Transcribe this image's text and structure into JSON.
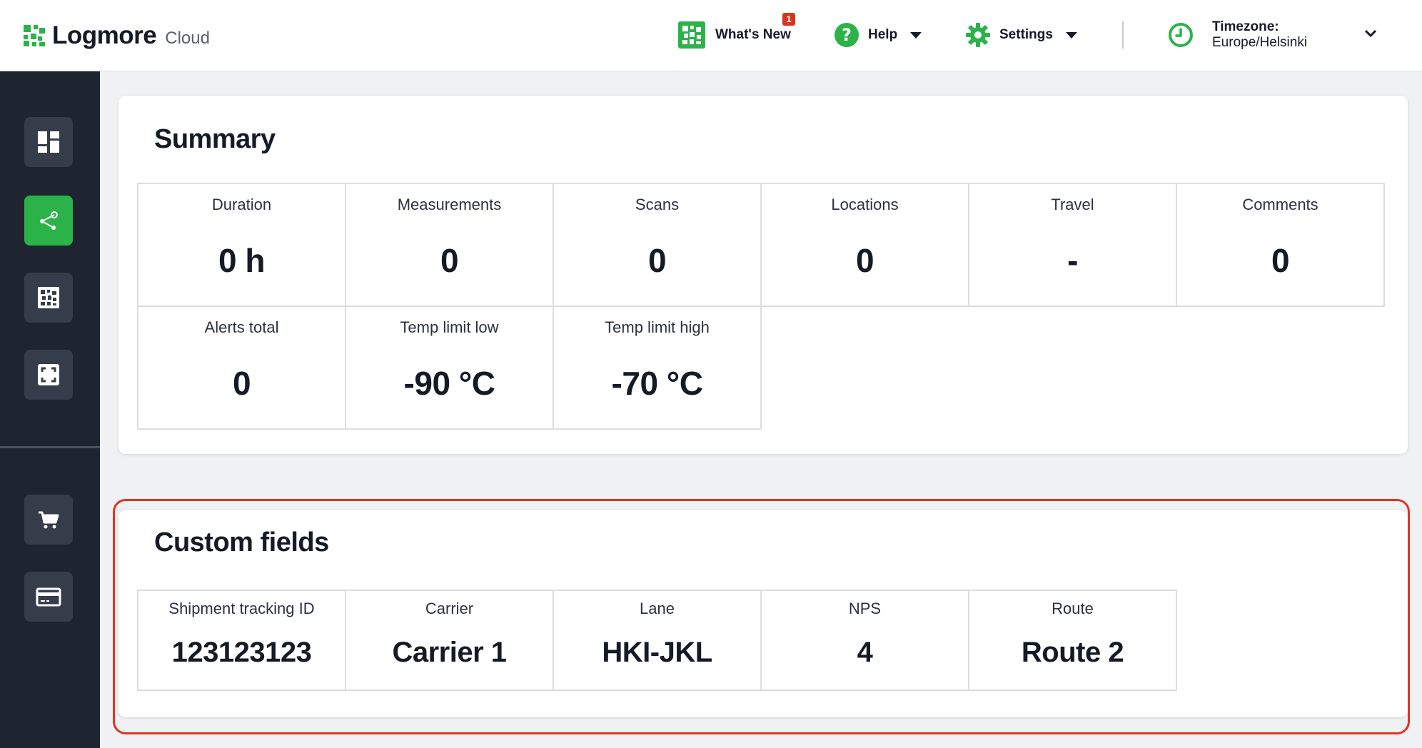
{
  "brand": {
    "name": "Logmore",
    "product": "Cloud"
  },
  "header": {
    "whats_new": {
      "label": "What's New",
      "badge": "1"
    },
    "help": {
      "label": "Help"
    },
    "settings": {
      "label": "Settings"
    },
    "timezone": {
      "title": "Timezone:",
      "value": "Europe/Helsinki"
    }
  },
  "sidebar": {
    "items": [
      {
        "name": "dashboard-icon",
        "active": false
      },
      {
        "name": "share-icon",
        "active": true
      },
      {
        "name": "qr-code-icon",
        "active": false
      },
      {
        "name": "scan-icon",
        "active": false
      },
      {
        "name": "cart-icon",
        "active": false
      },
      {
        "name": "credit-card-icon",
        "active": false
      }
    ]
  },
  "summary": {
    "title": "Summary",
    "cells": [
      {
        "label": "Duration",
        "value": "0 h"
      },
      {
        "label": "Measurements",
        "value": "0"
      },
      {
        "label": "Scans",
        "value": "0"
      },
      {
        "label": "Locations",
        "value": "0"
      },
      {
        "label": "Travel",
        "value": "-"
      },
      {
        "label": "Comments",
        "value": "0"
      },
      {
        "label": "Alerts total",
        "value": "0"
      },
      {
        "label": "Temp limit low",
        "value": "-90 °C"
      },
      {
        "label": "Temp limit high",
        "value": "-70 °C"
      }
    ]
  },
  "custom_fields": {
    "title": "Custom fields",
    "cells": [
      {
        "label": "Shipment tracking ID",
        "value": "123123123"
      },
      {
        "label": "Carrier",
        "value": "Carrier 1"
      },
      {
        "label": "Lane",
        "value": "HKI-JKL"
      },
      {
        "label": "NPS",
        "value": "4"
      },
      {
        "label": "Route",
        "value": "Route 2"
      }
    ]
  },
  "colors": {
    "accent": "#2bb34a",
    "sidebar": "#1e2430",
    "highlight": "#e23325",
    "badge": "#d9341e"
  }
}
